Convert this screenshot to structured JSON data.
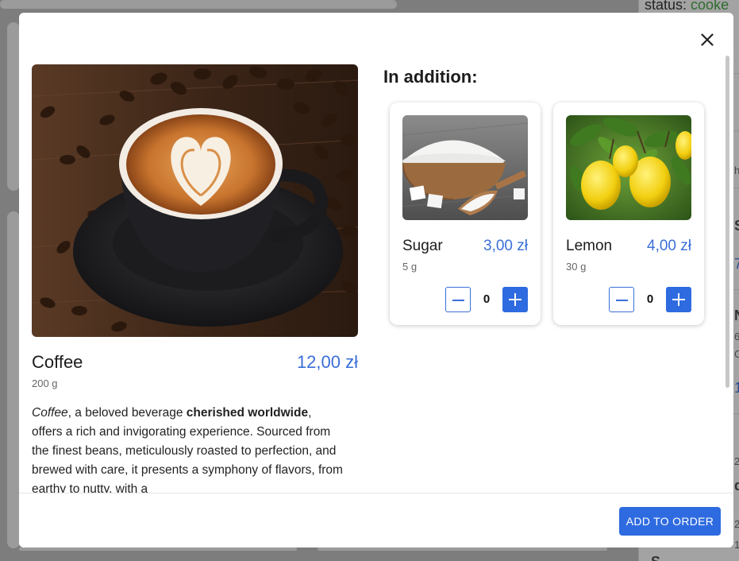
{
  "background": {
    "status_label": "status:",
    "status_value": "cooke",
    "fragments": [
      "S",
      "7",
      "N",
      "6",
      "C",
      "1",
      "h",
      "d",
      "2",
      "2",
      "S",
      "1"
    ]
  },
  "modal": {
    "close_icon": "close-icon",
    "product": {
      "name": "Coffee",
      "price": "12,00 zł",
      "weight": "200 g",
      "description": {
        "italic_word": "Coffee",
        "text_1": ", a beloved beverage ",
        "bold_words": "cherished worldwide",
        "text_2": ", offers a rich and invigorating experience. Sourced from the finest beans, meticulously roasted to perfection, and brewed with care, it presents a symphony of flavors, from earthy to nutty, with a"
      }
    },
    "addition_title": "In addition:",
    "addons": [
      {
        "name": "Sugar",
        "price": "3,00 zł",
        "weight": "5 g",
        "quantity": "0"
      },
      {
        "name": "Lemon",
        "price": "4,00 zł",
        "weight": "30 g",
        "quantity": "0"
      }
    ],
    "add_button_label": "ADD TO ORDER"
  },
  "colors": {
    "accent": "#2f6be0",
    "price": "#3a6fd8",
    "status_green": "#2e6b2e"
  }
}
